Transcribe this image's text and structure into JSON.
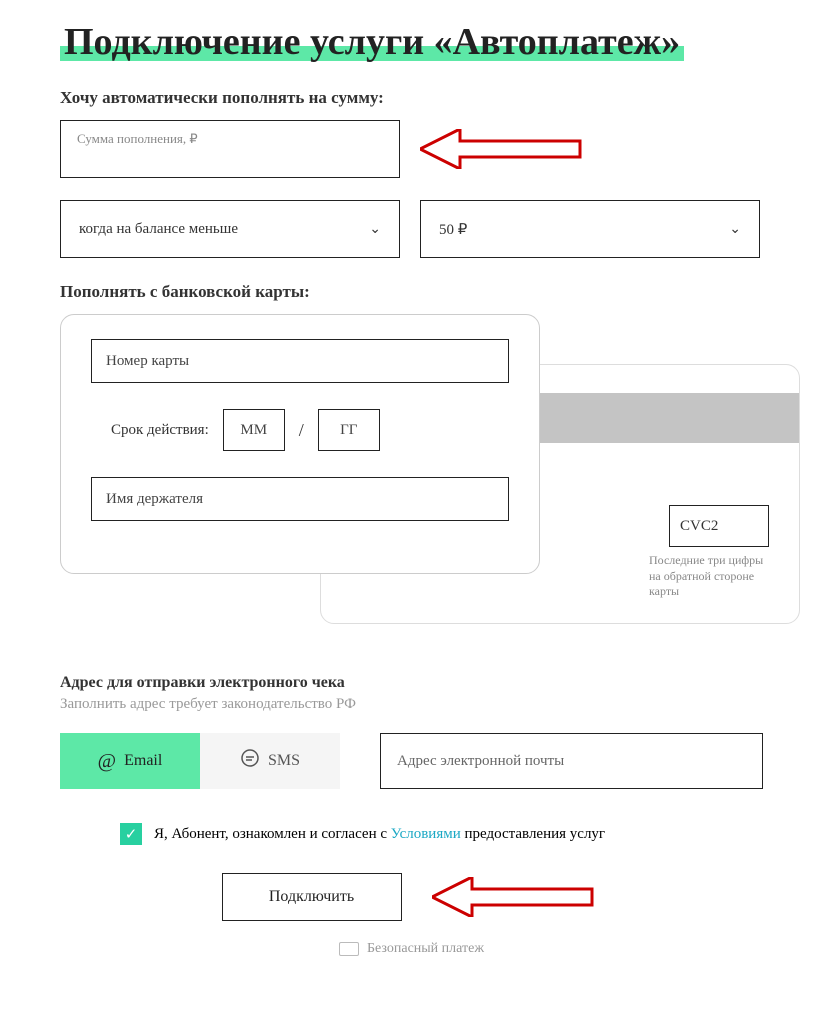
{
  "title": "Подключение услуги «Автоплатеж»",
  "amount": {
    "label": "Хочу автоматически пополнять на сумму:",
    "placeholder": "Сумма пополнения, ₽"
  },
  "condition_select": {
    "label": "когда на балансе меньше"
  },
  "threshold_select": {
    "label": "50 ₽"
  },
  "card": {
    "section_label": "Пополнять с банковской карты:",
    "number_placeholder": "Номер карты",
    "expiry_label": "Срок действия:",
    "mm_placeholder": "ММ",
    "yy_placeholder": "ГГ",
    "holder_placeholder": "Имя держателя",
    "cvc_placeholder": "CVC2",
    "cvc_hint": "Последние три цифры на обратной стороне карты"
  },
  "receipt": {
    "label": "Адрес для отправки электронного чека",
    "hint": "Заполнить адрес требует законодательство РФ",
    "tab_email": "Email",
    "tab_sms": "SMS",
    "email_placeholder": "Адрес электронной почты"
  },
  "consent": {
    "prefix": "Я, Абонент, ознакомлен и согласен с ",
    "link": "Условиями",
    "suffix": " предоставления услуг"
  },
  "submit_label": "Подключить",
  "secure_label": "Безопасный платеж"
}
